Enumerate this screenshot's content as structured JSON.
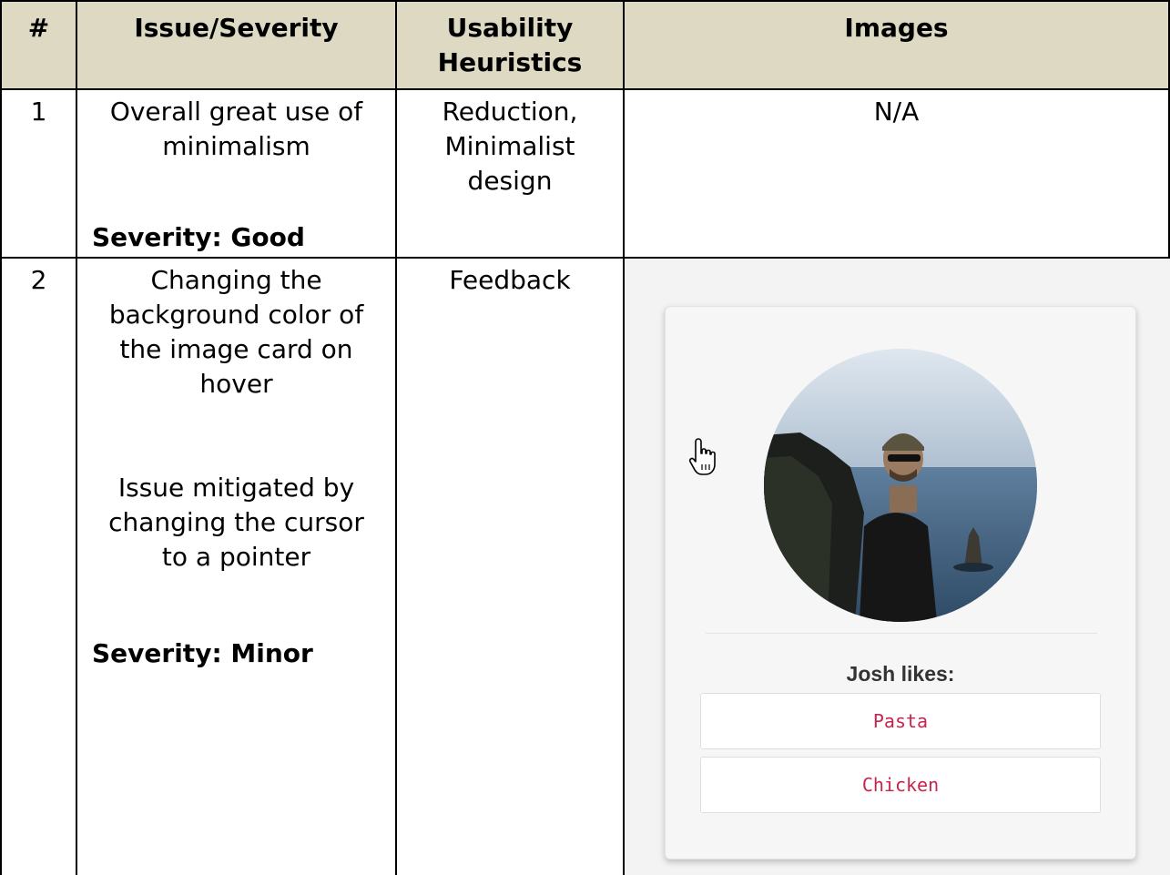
{
  "table": {
    "headers": {
      "num": "#",
      "issue": "Issue/Severity",
      "heuristics": "Usability Heuristics",
      "images": "Images"
    },
    "rows": [
      {
        "num": "1",
        "issue_lines": [
          "Overall great use of",
          "minimalism"
        ],
        "severity": "Severity: Good",
        "heuristics": [
          "Reduction,",
          "Minimalist",
          "design"
        ],
        "images": "N/A"
      },
      {
        "num": "2",
        "issue_lines": [
          "Changing the",
          "background color of",
          "the image card on",
          "hover"
        ],
        "mitigation_lines": [
          "Issue mitigated by",
          "changing the cursor",
          "to a pointer"
        ],
        "severity": "Severity: Minor",
        "heuristics": [
          "Feedback"
        ]
      }
    ]
  },
  "card": {
    "likes_title": "Josh likes:",
    "likes": [
      "Pasta",
      "Chicken"
    ]
  },
  "colors": {
    "header_bg": "#ddd9c3",
    "like_text": "#c7254e"
  },
  "icons": {
    "cursor": "hand-pointer-icon"
  }
}
